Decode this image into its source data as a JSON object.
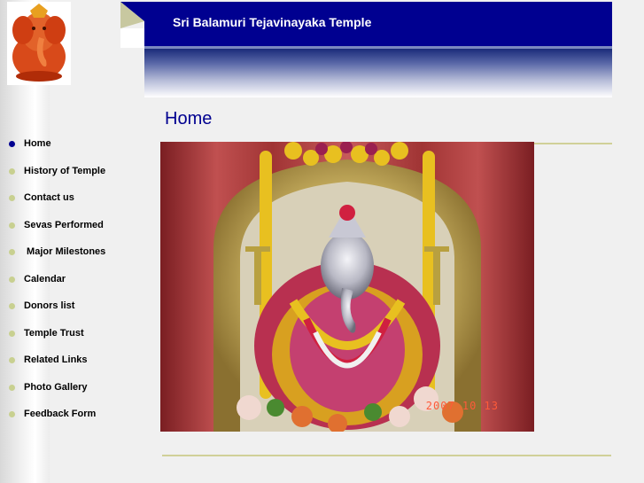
{
  "header": {
    "title": "Sri Balamuri Tejavinayaka Temple"
  },
  "page": {
    "title": "Home"
  },
  "nav": {
    "items": [
      {
        "label": "Home",
        "active": true
      },
      {
        "label": "History of Temple",
        "active": false
      },
      {
        "label": "Contact us",
        "active": false
      },
      {
        "label": "Sevas Performed",
        "active": false
      },
      {
        "label": " Major Milestones",
        "active": false
      },
      {
        "label": "Calendar",
        "active": false
      },
      {
        "label": "Donors list",
        "active": false
      },
      {
        "label": "Temple Trust",
        "active": false
      },
      {
        "label": "Related Links",
        "active": false
      },
      {
        "label": "Photo Gallery",
        "active": false
      },
      {
        "label": "Feedback Form",
        "active": false
      }
    ]
  },
  "photo": {
    "date_stamp": "2007 10 13"
  },
  "icons": {
    "logo": "ganesha-logo-icon",
    "bullet": "bullet-dot-icon"
  },
  "colors": {
    "header_blue": "#000090",
    "bullet_active": "#000090",
    "bullet_inactive": "#c8d090",
    "rule": "#d0d098"
  }
}
